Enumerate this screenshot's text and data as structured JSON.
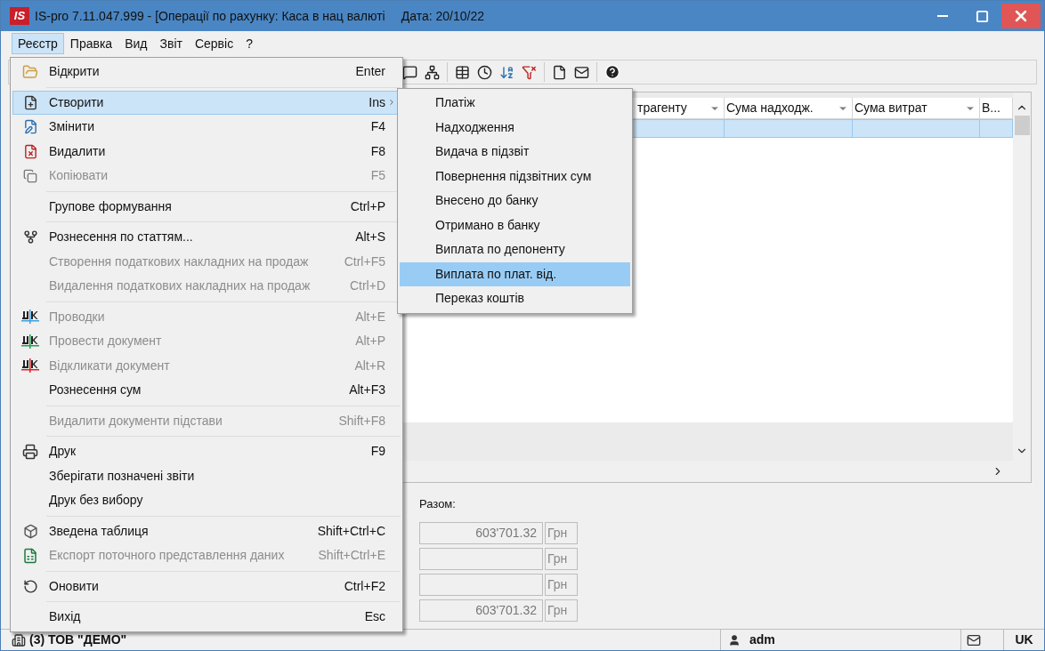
{
  "window": {
    "logo": "IS",
    "title": "IS-pro 7.11.047.999 - [Операції по рахунку: Каса в нац валюті",
    "date": "Дата: 20/10/22"
  },
  "menubar": [
    {
      "label": "Реєстр",
      "selected": true
    },
    {
      "label": "Правка",
      "selected": false
    },
    {
      "label": "Вид",
      "selected": false
    },
    {
      "label": "Звіт",
      "selected": false
    },
    {
      "label": "Сервіс",
      "selected": false
    },
    {
      "label": "?",
      "selected": false
    }
  ],
  "menu": [
    [
      {
        "label": "Відкрити",
        "shortcut": "Enter",
        "disabled": false,
        "selected": false,
        "submenu": false
      }
    ],
    [
      {
        "label": "Створити",
        "shortcut": "Ins",
        "disabled": false,
        "selected": true,
        "submenu": true
      },
      {
        "label": "Змінити",
        "shortcut": "F4",
        "disabled": false,
        "selected": false,
        "submenu": false
      },
      {
        "label": "Видалити",
        "shortcut": "F8",
        "disabled": false,
        "selected": false,
        "submenu": false
      },
      {
        "label": "Копіювати",
        "shortcut": "F5",
        "disabled": true,
        "selected": false,
        "submenu": false
      }
    ],
    [
      {
        "label": "Групове формування",
        "shortcut": "Ctrl+P",
        "disabled": false,
        "selected": false,
        "submenu": false
      }
    ],
    [
      {
        "label": "Рознесення по статтям...",
        "shortcut": "Alt+S",
        "disabled": false,
        "selected": false,
        "submenu": false
      },
      {
        "label": "Створення податкових накладних на продаж",
        "shortcut": "Ctrl+F5",
        "disabled": true,
        "selected": false,
        "submenu": false
      },
      {
        "label": "Видалення податкових накладних на продаж",
        "shortcut": "Ctrl+D",
        "disabled": true,
        "selected": false,
        "submenu": false
      }
    ],
    [
      {
        "label": "Проводки",
        "shortcut": "Alt+E",
        "disabled": true,
        "selected": false,
        "submenu": false
      },
      {
        "label": "Провести документ",
        "shortcut": "Alt+P",
        "disabled": true,
        "selected": false,
        "submenu": false
      },
      {
        "label": "Відкликати документ",
        "shortcut": "Alt+R",
        "disabled": true,
        "selected": false,
        "submenu": false
      },
      {
        "label": "Рознесення сум",
        "shortcut": "Alt+F3",
        "disabled": false,
        "selected": false,
        "submenu": false
      }
    ],
    [
      {
        "label": "Видалити документи підстави",
        "shortcut": "Shift+F8",
        "disabled": true,
        "selected": false,
        "submenu": false
      }
    ],
    [
      {
        "label": "Друк",
        "shortcut": "F9",
        "disabled": false,
        "selected": false,
        "submenu": false
      },
      {
        "label": "Зберігати позначені звіти",
        "disabled": false,
        "selected": false,
        "submenu": false
      },
      {
        "label": "Друк без вибору",
        "disabled": false,
        "selected": false,
        "submenu": false
      }
    ],
    [
      {
        "label": "Зведена таблиця",
        "shortcut": "Shift+Ctrl+C",
        "disabled": false,
        "selected": false,
        "submenu": false
      },
      {
        "label": "Експорт поточного представлення даних",
        "shortcut": "Shift+Ctrl+E",
        "disabled": true,
        "selected": false,
        "submenu": false
      }
    ],
    [
      {
        "label": "Оновити",
        "shortcut": "Ctrl+F2",
        "disabled": false,
        "selected": false,
        "submenu": false
      }
    ],
    [
      {
        "label": "Вихід",
        "shortcut": "Esc",
        "disabled": false,
        "selected": false,
        "submenu": false
      }
    ]
  ],
  "submenu": [
    {
      "label": "Платіж",
      "selected": false
    },
    {
      "label": "Надходження",
      "selected": false
    },
    {
      "label": "Видача в підзвіт",
      "selected": false
    },
    {
      "label": "Повернення підзвітних сум",
      "selected": false
    },
    {
      "label": "Внесено до банку",
      "selected": false
    },
    {
      "label": "Отримано в банку",
      "selected": false
    },
    {
      "label": "Виплата по депоненту",
      "selected": false
    },
    {
      "label": "Виплата по плат. від.",
      "selected": true
    },
    {
      "label": "Переказ коштів",
      "selected": false
    }
  ],
  "table": {
    "columns": [
      "трагенту",
      "Сума надходж.",
      "Сума витрат",
      "В..."
    ]
  },
  "totals": {
    "label": "Разом:",
    "rows": [
      {
        "value": "603'701.32",
        "currency": "Грн"
      },
      {
        "currency": "Грн"
      },
      {
        "currency": "Грн"
      },
      {
        "value": "603'701.32",
        "currency": "Грн"
      }
    ]
  },
  "status_bar": {
    "company": "(3) ТОВ \"ДЕМО\"",
    "user": "adm",
    "language": "UK"
  }
}
